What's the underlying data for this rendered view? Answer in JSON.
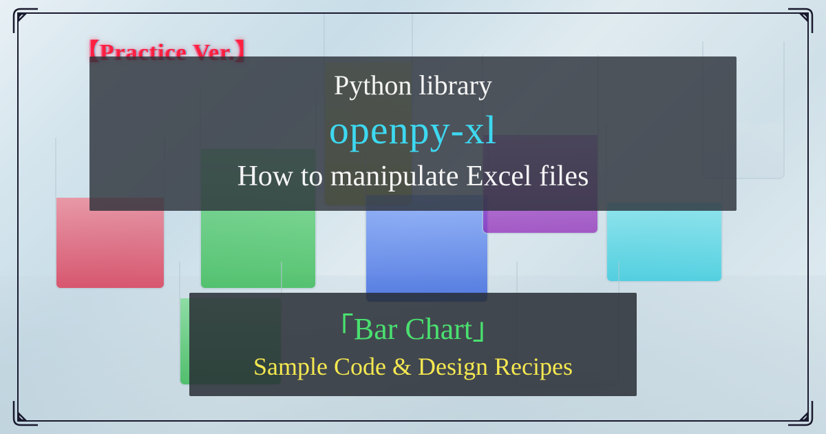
{
  "badge": {
    "practice": "【Practice Ver.】"
  },
  "main_banner": {
    "library_line": "Python library",
    "package_name": "openpy-xl",
    "howto_line": "How to manipulate Excel files"
  },
  "sub_banner": {
    "chart_type": "「Bar Chart」",
    "subtitle": "Sample Code & Design Recipes"
  },
  "colors": {
    "badge_red": "#ff2040",
    "cyan_accent": "#3dd8f0",
    "green_accent": "#4ae070",
    "yellow_accent": "#f5e850",
    "banner_bg": "rgba(45,50,58,0.82)",
    "frame_color": "#1a1a2e"
  }
}
